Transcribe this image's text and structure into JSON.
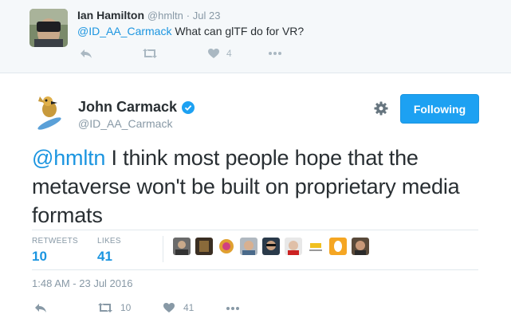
{
  "parent_tweet": {
    "author_name": "Ian Hamilton",
    "author_handle": "@hmltn",
    "date": "· Jul 23",
    "mention": "@ID_AA_Carmack",
    "text": " What can glTF do for VR?",
    "like_count": "4",
    "icons": [
      "reply-icon",
      "retweet-icon",
      "heart-icon",
      "more-icon"
    ]
  },
  "tweet": {
    "author_name": "John Carmack",
    "author_handle": "@ID_AA_Carmack",
    "follow_label": "Following",
    "mention": "@hmltn",
    "text": " I think most people hope that the metaverse won't be built on proprietary media formats",
    "retweets_label": "RETWEETS",
    "retweets_count": "10",
    "likes_label": "LIKES",
    "likes_count": "41",
    "timestamp": "1:48 AM - 23 Jul 2016",
    "action_retweet_count": "10",
    "action_like_count": "41",
    "liker_avatar_count": 9
  },
  "colors": {
    "accent": "#1da1f2",
    "link": "#1b95e0",
    "muted": "#8899a6",
    "text": "#292f33",
    "parent_bg": "#f5f8fa"
  }
}
